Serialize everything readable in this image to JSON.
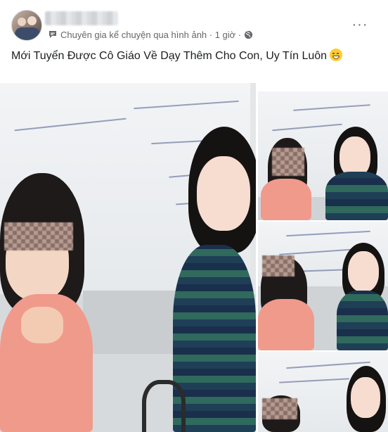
{
  "post": {
    "meta_text": "Chuyên gia kể chuyện qua hình ảnh · 1 giờ ·",
    "caption": "Mới Tuyển Được Cô Giáo Về Dạy Thêm Cho Con, Uy Tín Luôn",
    "menu_label": "···"
  },
  "icons": {
    "meta_leading": "chat-bubble-icon",
    "privacy": "globe-icon",
    "emoji": "grinning-face-emoji"
  },
  "colors": {
    "meta_text": "#65676b",
    "caption_text": "#1c1e21"
  }
}
